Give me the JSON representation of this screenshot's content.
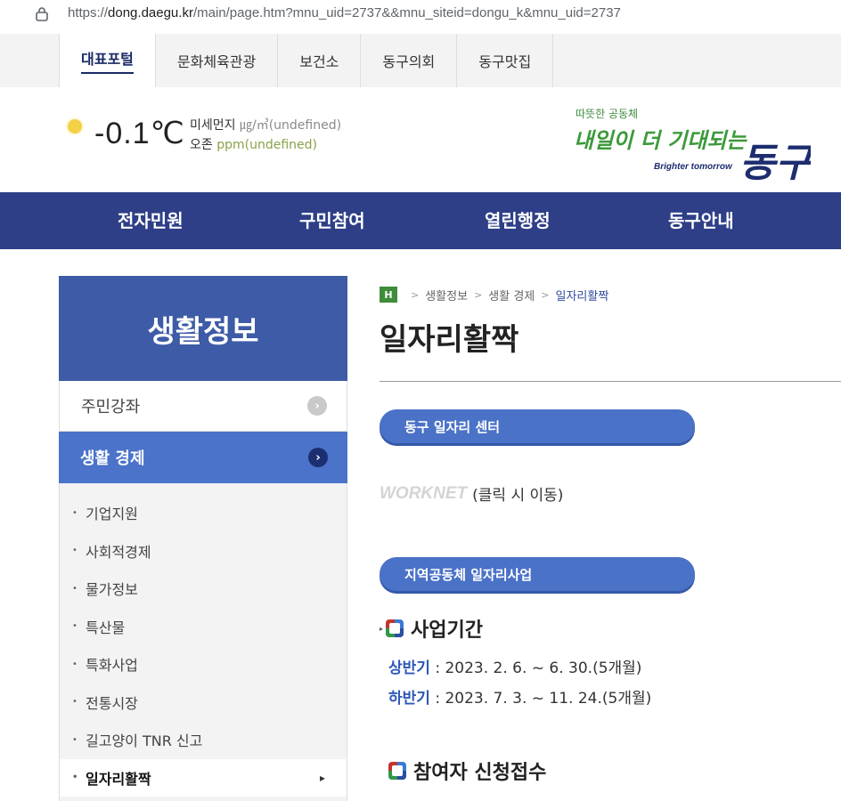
{
  "browser": {
    "url_prefix": "https://",
    "url_host": "dong.daegu.kr",
    "url_path": "/main/page.htm?mnu_uid=2737&&mnu_siteid=dongu_k&mnu_uid=2737"
  },
  "portal_tabs": [
    "대표포털",
    "문화체육관광",
    "보건소",
    "동구의회",
    "동구맛집"
  ],
  "weather": {
    "icon": "sun-icon",
    "temperature": "-0.1℃",
    "dust_label": "미세먼지",
    "dust_value": "㎍/㎥(undefined)",
    "ozone_label": "오존",
    "ozone_value": "ppm(undefined)"
  },
  "logo": {
    "top_text": "따뜻한 공동체",
    "main_text": "내일이 더 기대되는",
    "big_text": "동구",
    "en_text": "Brighter tomorrow"
  },
  "main_nav": [
    "전자민원",
    "구민참여",
    "열린행정",
    "동구안내"
  ],
  "sidebar": {
    "title": "생활정보",
    "items": [
      {
        "label": "주민강좌"
      },
      {
        "label": "생활 경제"
      }
    ],
    "sub_items": [
      "기업지원",
      "사회적경제",
      "물가정보",
      "특산물",
      "특화사업",
      "전통시장",
      "길고양이 TNR 신고",
      "일자리활짝"
    ]
  },
  "breadcrumb": {
    "home": "H",
    "items": [
      "생활정보",
      "생활 경제",
      "일자리활짝"
    ]
  },
  "content": {
    "title": "일자리활짝",
    "section1_pill": "동구 일자리 센터",
    "worknet_logo": "WORKNET",
    "worknet_text": "(클릭 시 이동)",
    "section2_pill": "지역공동체 일자리사업",
    "period_heading": "사업기간",
    "first_half_label": "상반기",
    "first_half_value": " : 2023. 2. 6. ~  6. 30.(5개월)",
    "second_half_label": "하반기",
    "second_half_value": " : 2023. 7. 3. ~ 11. 24.(5개월)",
    "apply_heading": "참여자 신청접수"
  },
  "colors": {
    "nav": "#2e3f88",
    "sidebar_hero": "#3d5ba6",
    "sidebar_active": "#4a73c9",
    "pill": "#4a72c7",
    "breadcrumb_home": "#3f8c3a"
  }
}
